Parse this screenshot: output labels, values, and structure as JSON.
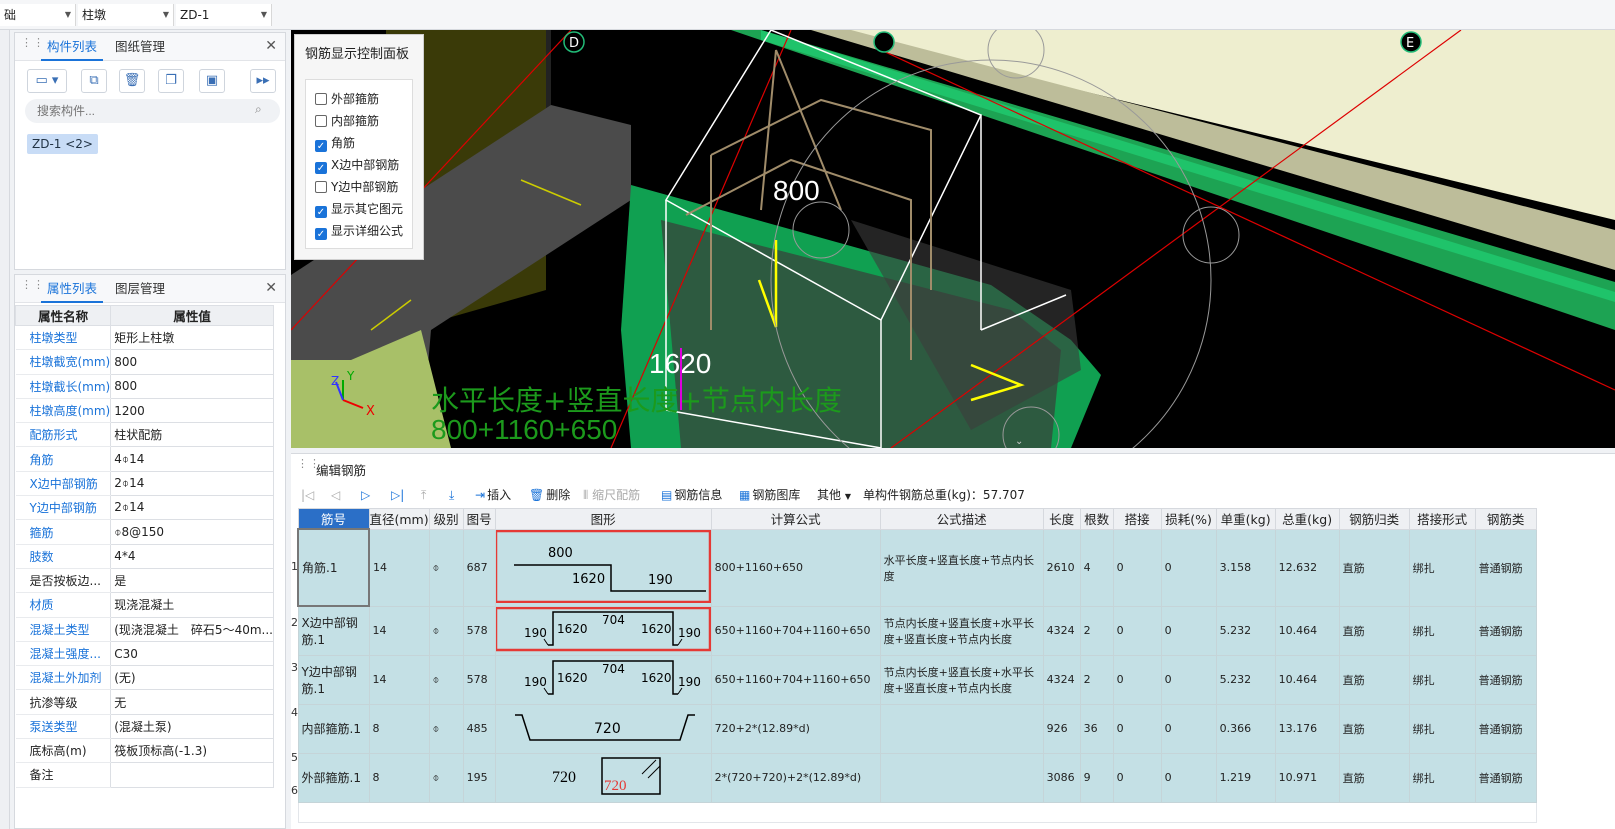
{
  "topbar": {
    "combo1": "础",
    "combo2": "柱墩",
    "combo3": "ZD-1"
  },
  "component_panel": {
    "tabs": [
      "构件列表",
      "图纸管理"
    ],
    "search_placeholder": "搜索构件...",
    "item": "ZD-1 <2>"
  },
  "property_panel": {
    "tabs": [
      "属性列表",
      "图层管理"
    ],
    "headers": [
      "属性名称",
      "属性值"
    ],
    "rows": [
      {
        "name": "柱墩类型",
        "value": "矩形上柱墩"
      },
      {
        "name": "柱墩截宽(mm)",
        "value": "800"
      },
      {
        "name": "柱墩截长(mm)",
        "value": "800"
      },
      {
        "name": "柱墩高度(mm)",
        "value": "1200"
      },
      {
        "name": "配筋形式",
        "value": "柱状配筋"
      },
      {
        "name": "角筋",
        "value": "4⌽14"
      },
      {
        "name": "X边中部钢筋",
        "value": "2⌽14"
      },
      {
        "name": "Y边中部钢筋",
        "value": "2⌽14"
      },
      {
        "name": "箍筋",
        "value": "⌽8@150"
      },
      {
        "name": "肢数",
        "value": "4*4"
      },
      {
        "name": "是否按板边...",
        "value": "是"
      },
      {
        "name": "材质",
        "value": "现浇混凝土"
      },
      {
        "name": "混凝土类型",
        "value": "(现浇混凝土　碎石5～40m..."
      },
      {
        "name": "混凝土强度...",
        "value": "C30"
      },
      {
        "name": "混凝土外加剂",
        "value": "(无)"
      },
      {
        "name": "抗渗等级",
        "value": "无"
      },
      {
        "name": "泵送类型",
        "value": "(混凝土泵)"
      },
      {
        "name": "底标高(m)",
        "value": "筏板顶标高(-1.3)"
      },
      {
        "name": "备注",
        "value": ""
      }
    ]
  },
  "control_panel": {
    "title": "钢筋显示控制面板",
    "options": [
      {
        "label": "外部箍筋",
        "checked": false
      },
      {
        "label": "内部箍筋",
        "checked": false
      },
      {
        "label": "角筋",
        "checked": true
      },
      {
        "label": "X边中部钢筋",
        "checked": true
      },
      {
        "label": "Y边中部钢筋",
        "checked": false
      },
      {
        "label": "显示其它图元",
        "checked": true
      },
      {
        "label": "显示详细公式",
        "checked": true
      }
    ]
  },
  "viewport": {
    "dim_800": "800",
    "dim_1620": "1620",
    "formula_label": "水平长度+竖直长度+节点内长度",
    "formula_value": "800+1160+650",
    "axis_d": "D",
    "axis_e": "E",
    "axis_x": "X",
    "axis_y": "Y",
    "axis_z": "Z"
  },
  "rebar_panel": {
    "title": "编辑钢筋",
    "toolbar": {
      "insert": "插入",
      "delete": "删除",
      "scale": "缩尺配筋",
      "info": "钢筋信息",
      "library": "钢筋图库",
      "other": "其他",
      "total": "单构件钢筋总重(kg)：57.707"
    },
    "columns": [
      "筋号",
      "直径(mm)",
      "级别",
      "图号",
      "图形",
      "计算公式",
      "公式描述",
      "长度",
      "根数",
      "搭接",
      "损耗(%)",
      "单重(kg)",
      "总重(kg)",
      "钢筋归类",
      "搭接形式",
      "钢筋类"
    ],
    "rows": [
      {
        "no": "1",
        "name": "角筋.1",
        "dia": "14",
        "grade": "⌽",
        "fig": "687",
        "formula": "800+1160+650",
        "desc": "水平长度+竖直长度+节点内长度",
        "len": "2610",
        "count": "4",
        "lap": "0",
        "loss": "0",
        "unit": "3.158",
        "total": "12.632",
        "cat": "直筋",
        "lapform": "绑扎",
        "type": "普通钢筋",
        "shape": {
          "a": "800",
          "b": "1620",
          "c": "190"
        }
      },
      {
        "no": "2",
        "name": "X边中部钢筋.1",
        "dia": "14",
        "grade": "⌽",
        "fig": "578",
        "formula": "650+1160+704+1160+650",
        "desc": "节点内长度+竖直长度+水平长度+竖直长度+节点内长度",
        "len": "4324",
        "count": "2",
        "lap": "0",
        "loss": "0",
        "unit": "5.232",
        "total": "10.464",
        "cat": "直筋",
        "lapform": "绑扎",
        "type": "普通钢筋",
        "shape": {
          "a": "190",
          "b": "1620",
          "c": "704",
          "d": "1620",
          "e": "190"
        }
      },
      {
        "no": "3",
        "name": "Y边中部钢筋.1",
        "dia": "14",
        "grade": "⌽",
        "fig": "578",
        "formula": "650+1160+704+1160+650",
        "desc": "节点内长度+竖直长度+水平长度+竖直长度+节点内长度",
        "len": "4324",
        "count": "2",
        "lap": "0",
        "loss": "0",
        "unit": "5.232",
        "total": "10.464",
        "cat": "直筋",
        "lapform": "绑扎",
        "type": "普通钢筋",
        "shape": {
          "a": "190",
          "b": "1620",
          "c": "704",
          "d": "1620",
          "e": "190"
        }
      },
      {
        "no": "4",
        "name": "内部箍筋.1",
        "dia": "8",
        "grade": "⌽",
        "fig": "485",
        "formula": "720+2*(12.89*d)",
        "desc": "",
        "len": "926",
        "count": "36",
        "lap": "0",
        "loss": "0",
        "unit": "0.366",
        "total": "13.176",
        "cat": "直筋",
        "lapform": "绑扎",
        "type": "普通钢筋",
        "shape": {
          "a": "720"
        }
      },
      {
        "no": "5",
        "name": "外部箍筋.1",
        "dia": "8",
        "grade": "⌽",
        "fig": "195",
        "formula": "2*(720+720)+2*(12.89*d)",
        "desc": "",
        "len": "3086",
        "count": "9",
        "lap": "0",
        "loss": "0",
        "unit": "1.219",
        "total": "10.971",
        "cat": "直筋",
        "lapform": "绑扎",
        "type": "普通钢筋",
        "shape": {
          "a": "720",
          "b": "720"
        }
      }
    ],
    "empty_row_no": "6"
  }
}
